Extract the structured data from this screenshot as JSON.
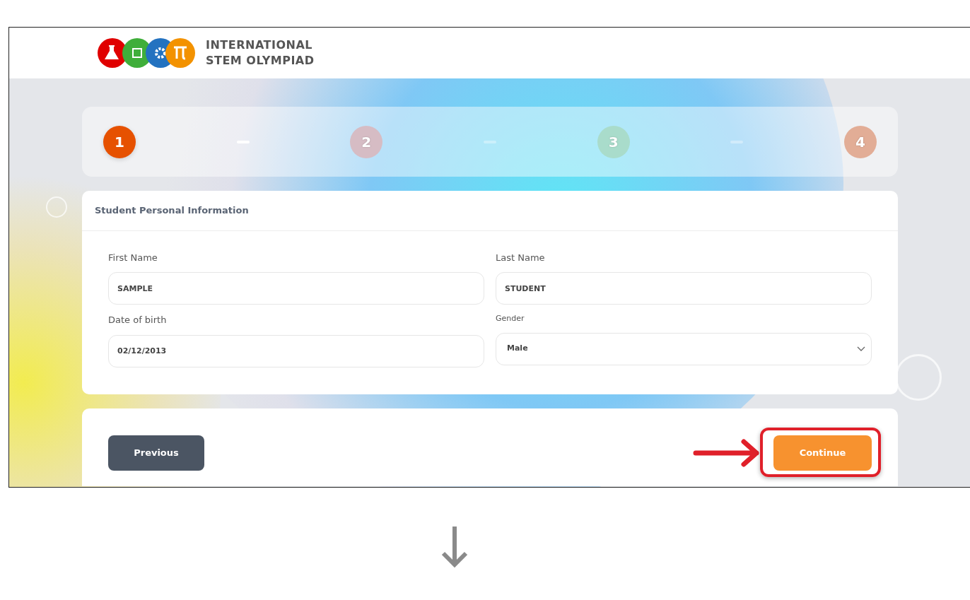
{
  "header": {
    "logo_lines": [
      "INTERNATIONAL",
      "STEM OLYMPIAD"
    ]
  },
  "steps": [
    {
      "label": "1",
      "selected": true,
      "color": "#e65100"
    },
    {
      "label": "2",
      "selected": false,
      "color": "#d6bcc4"
    },
    {
      "label": "3",
      "selected": false,
      "color": "#a9dccb"
    },
    {
      "label": "4",
      "selected": false,
      "color": "#e2ad96"
    }
  ],
  "form": {
    "title": "Student Personal Information",
    "fields": [
      {
        "kind": "text",
        "label": "First Name",
        "value": "SAMPLE"
      },
      {
        "kind": "text",
        "label": "Last Name",
        "value": "STUDENT"
      },
      {
        "kind": "text",
        "label": "Date of birth",
        "value": "02/12/2013"
      },
      {
        "kind": "select",
        "label": "Gender",
        "value": "Male"
      }
    ]
  },
  "buttons": [
    {
      "kind": "secondary",
      "label": "Previous",
      "highlighted": false
    },
    {
      "kind": "primary",
      "label": "Continue",
      "highlighted": true
    }
  ]
}
